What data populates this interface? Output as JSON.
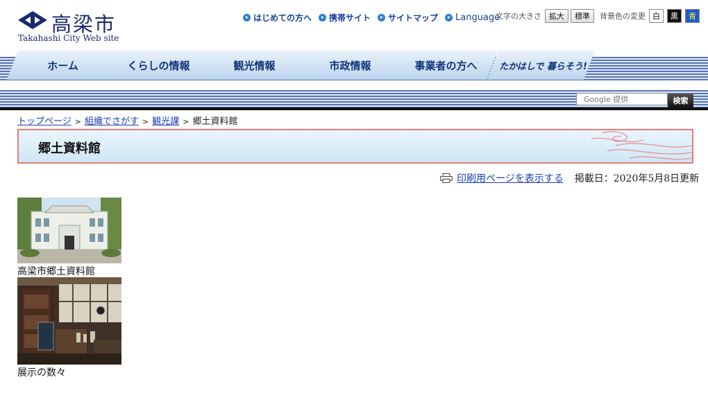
{
  "header": {
    "logo_name": "高梁市",
    "logo_sub": "Takahashi City Web site",
    "links": [
      {
        "label": "はじめての方へ"
      },
      {
        "label": "携帯サイト"
      },
      {
        "label": "サイトマップ"
      },
      {
        "label": "Language"
      }
    ],
    "text_size_label": "文字の大きさ",
    "text_size_options": [
      "拡大",
      "標準"
    ],
    "bg_color_label": "背景色の変更",
    "bg_color_options": [
      "白",
      "黒",
      "青"
    ]
  },
  "nav": {
    "items": [
      "ホーム",
      "くらしの情報",
      "観光情報",
      "市政情報",
      "事業者の方へ",
      "たかはしで 暮らそう!"
    ]
  },
  "search": {
    "placeholder": "Google 提供",
    "button": "検索"
  },
  "breadcrumb": {
    "items": [
      "トップページ",
      "組織でさがす",
      "観光課"
    ],
    "current": "郷土資料館",
    "separator": ">"
  },
  "page": {
    "title": "郷土資料館",
    "print_link": "印刷用ページを表示する",
    "updated": "掲載日：2020年5月8日更新"
  },
  "photos": [
    {
      "caption": "高梁市郷土資料館"
    },
    {
      "caption": "展示の数々"
    }
  ],
  "colors": {
    "brand": "#1a2a6c",
    "link": "#1a3fb5",
    "title_border": "#e87a78"
  }
}
